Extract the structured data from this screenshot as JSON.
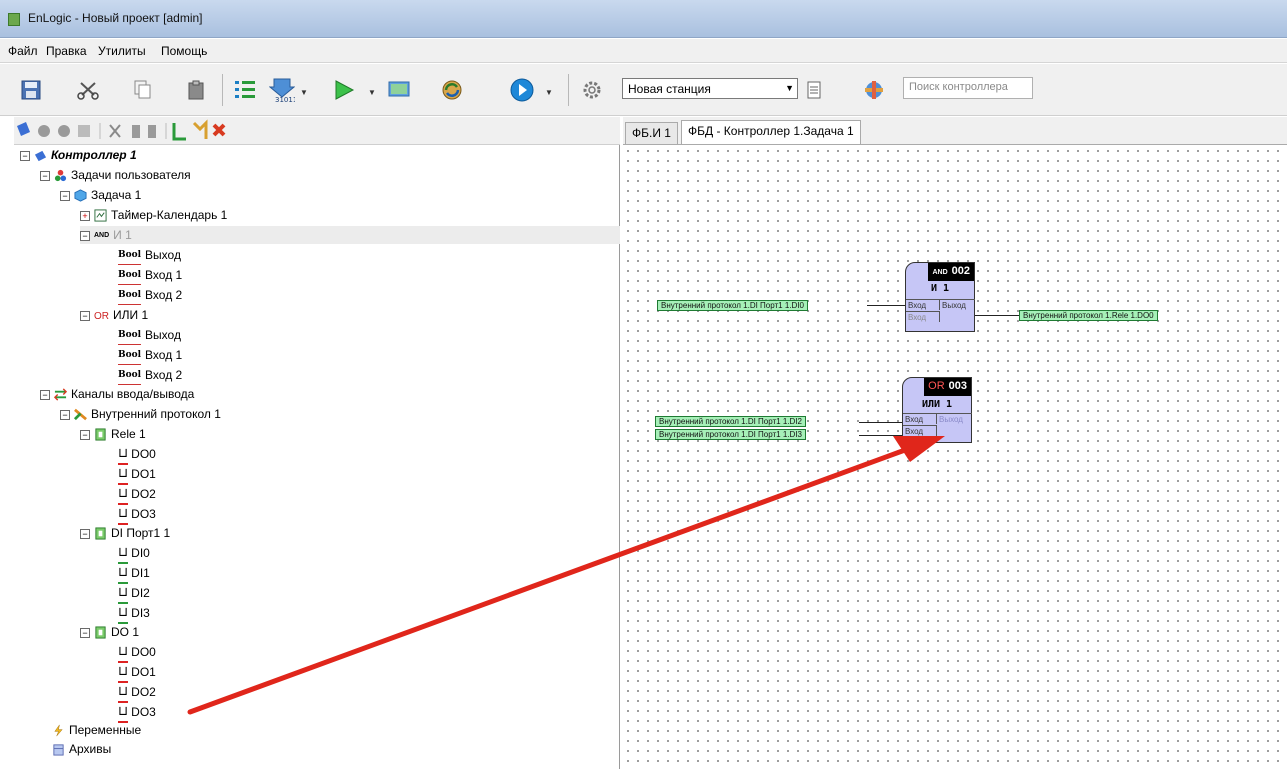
{
  "window": {
    "title": "EnLogic - Новый проект [admin]"
  },
  "menu": [
    "Файл",
    "Правка",
    "Утилиты",
    "Помощь"
  ],
  "toolbar": {
    "station": "Новая станция",
    "search_placeholder": "Поиск контроллера",
    "counter_icon_text": "31011"
  },
  "tree": {
    "controller": "Контроллер 1",
    "user_tasks": "Задачи пользователя",
    "task": "Задача 1",
    "timer": "Таймер-Календарь 1",
    "and_block": "И 1",
    "and_tag": "AND",
    "or_block": "ИЛИ 1",
    "or_tag": "OR",
    "out": "Выход",
    "in1": "Вход 1",
    "in2": "Вход 2",
    "bool": "Bool",
    "io": "Каналы ввода/вывода",
    "protocol": "Внутренний протокол 1",
    "rele": "Rele 1",
    "di_port": "DI Порт1 1",
    "do1": "DO 1",
    "do": [
      "DO0",
      "DO1",
      "DO2",
      "DO3"
    ],
    "di": [
      "DI0",
      "DI1",
      "DI2",
      "DI3"
    ],
    "variables": "Переменные",
    "archives": "Архивы"
  },
  "canvas": {
    "tabs": [
      "ФБ.И 1",
      "ФБД - Контроллер 1.Задача 1"
    ],
    "block_and": {
      "tag": "AND",
      "num": "002",
      "title": "И 1",
      "in": "Вход",
      "out": "Выход"
    },
    "block_or": {
      "tag": "OR",
      "num": "003",
      "title": "ИЛИ 1",
      "in": "Вход",
      "out": "Выход"
    },
    "sig_and_in": "Внутренний протокол 1.DI Порт1 1.DI0",
    "sig_and_out": "Внутренний протокол 1.Rele 1.DO0",
    "sig_or_in1": "Внутренний протокол 1.DI Порт1 1.DI2",
    "sig_or_in2": "Внутренний протокол 1.DI Порт1 1.DI3"
  },
  "colors": {
    "arrow": "#e0261b",
    "signal": "#a6f0b8",
    "block": "#c6c6f6"
  }
}
